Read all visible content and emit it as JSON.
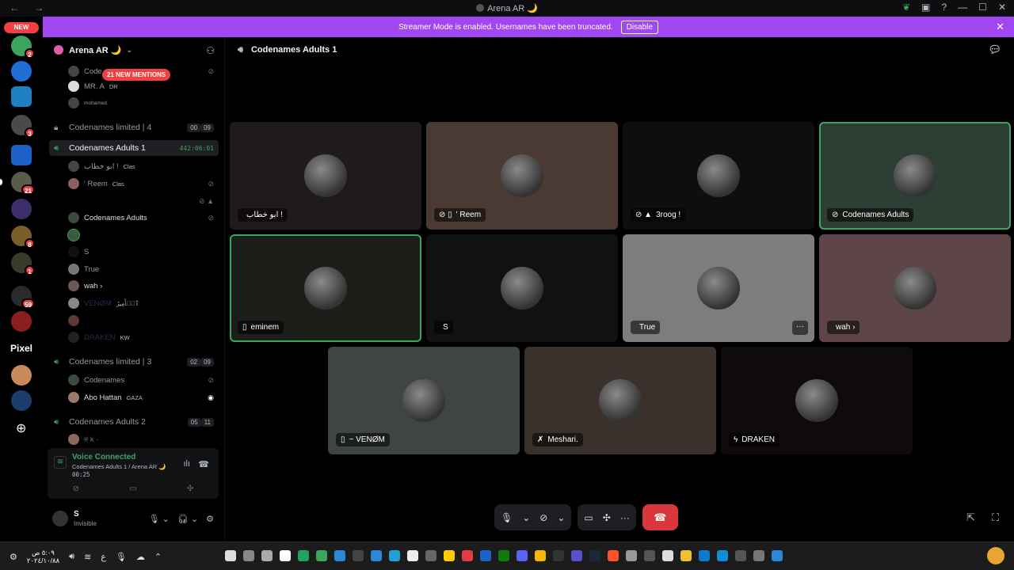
{
  "window": {
    "title": "Arena AR 🌙",
    "nav": "← →"
  },
  "rail": {
    "new_label": "NEW",
    "pixel_label": "Pixel",
    "badges": [
      "2",
      "3",
      "21",
      "8",
      "1",
      "59"
    ]
  },
  "banner": {
    "text": "Streamer Mode is enabled. Usernames have been truncated.",
    "button": "Disable"
  },
  "guild": {
    "name": "Arena AR 🌙",
    "mentions_pill": "21 NEW MENTIONS"
  },
  "sidebar": {
    "top_users": [
      {
        "name": "Code",
        "tag": ""
      },
      {
        "name": "MR. A",
        "tag": "DR"
      },
      {
        "name": "mohamed",
        "tag": ""
      }
    ],
    "channels": [
      {
        "name": "Codenames limited | 4",
        "count_a": "00",
        "count_b": "09",
        "locked": true
      },
      {
        "name": "Codenames Adults 1",
        "timer": "442:06:01",
        "active": true
      },
      {
        "name": "Codenames limited | 3",
        "count_a": "02",
        "count_b": "09"
      },
      {
        "name": "Codenames Adults 2",
        "count_a": "05",
        "count_b": "11"
      }
    ],
    "adults1_users": [
      {
        "name": "ابو خطاب !",
        "tag": "Clas"
      },
      {
        "name": "' Reem",
        "tag": "Clas"
      },
      {
        "name": "",
        "tag": ""
      },
      {
        "name": "Codenames Adults",
        "tag": ""
      },
      {
        "name": "",
        "tag": ""
      },
      {
        "name": "S",
        "tag": ""
      },
      {
        "name": "True",
        "tag": ""
      },
      {
        "name": "wah ›",
        "tag": ""
      },
      {
        "name": "VENØM",
        "tag": "ٱلۡأَمِيرُ"
      },
      {
        "name": "",
        "tag": ""
      },
      {
        "name": "DRAKEN",
        "tag": "KW"
      }
    ],
    "limited3_users": [
      {
        "name": "Codenames",
        "tag": ""
      },
      {
        "name": "Abo Hattan",
        "tag": "GAZA"
      }
    ],
    "adults2_users": [
      {
        "name": "# k ·",
        "tag": ""
      }
    ]
  },
  "voice_panel": {
    "status": "Voice Connected",
    "channel": "Codenames Adults 1 / Arena AR 🌙",
    "time": "00:25"
  },
  "user_panel": {
    "name": "S",
    "status": "Invisible"
  },
  "stage": {
    "channel_title": "Codenames Adults 1",
    "tiles": [
      {
        "label": "ابو خطاب !",
        "icons": "",
        "bg": "#1f1b1a",
        "speaking": false
      },
      {
        "label": "' Reem",
        "icons": "⊘ ▯",
        "bg": "#4a3a33",
        "speaking": false
      },
      {
        "label": "3roog !",
        "icons": "⊘ ▲",
        "bg": "#0f0d0d",
        "speaking": false
      },
      {
        "label": "Codenames Adults",
        "icons": "⊘",
        "bg": "#2d3e35",
        "speaking": true
      },
      {
        "label": "eminem",
        "icons": "▯",
        "bg": "#1c1e1a",
        "speaking": true
      },
      {
        "label": "S",
        "icons": "",
        "bg": "#111111",
        "speaking": false
      },
      {
        "label": "True",
        "icons": "",
        "bg": "#7d7d7d",
        "speaking": false
      },
      {
        "label": "wah ›",
        "icons": "",
        "bg": "#5c4447",
        "speaking": false
      },
      {
        "label": "~ VENØM",
        "icons": "▯",
        "bg": "#3e4544",
        "speaking": false
      },
      {
        "label": "Meshari.",
        "icons": "✗",
        "bg": "#3a302c",
        "speaking": false
      },
      {
        "label": "DRAKEN",
        "icons": "ϟ",
        "bg": "#0f0b0b",
        "speaking": false
      }
    ]
  },
  "taskbar": {
    "clock_time": "٥:٠٩ ص",
    "clock_date": "٢٠٢٤/١٠/٨٨"
  }
}
